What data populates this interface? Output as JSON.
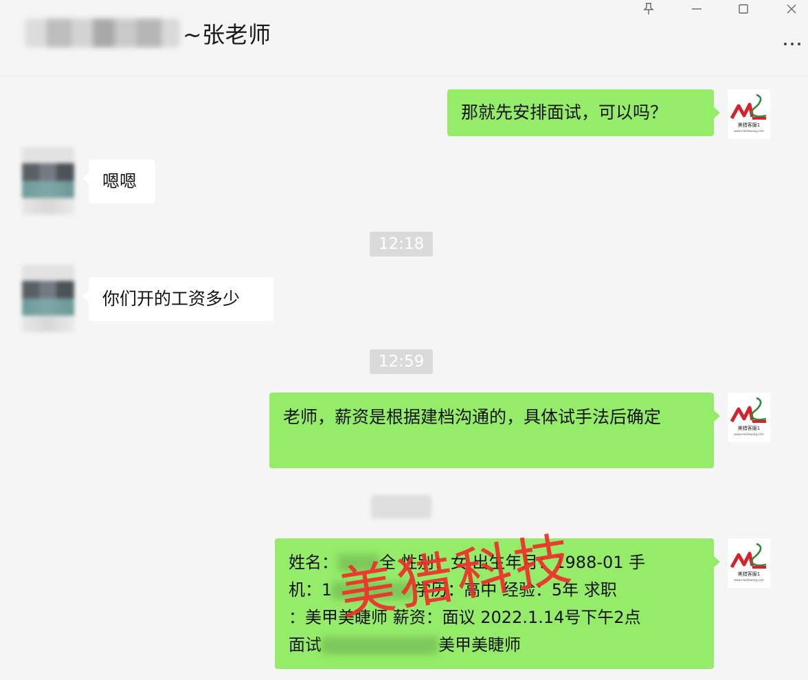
{
  "header": {
    "title": "~张老师",
    "pin_icon": "pin-icon",
    "minimize_icon": "minimize-icon",
    "maximize_icon": "maximize-icon",
    "close_icon": "close-icon",
    "more_icon": "more-icon"
  },
  "messages": [
    {
      "from": "me",
      "text": "那就先安排面试，可以吗？"
    },
    {
      "from": "other",
      "text": "嗯嗯"
    },
    {
      "time": "12:18"
    },
    {
      "from": "other",
      "text": "你们开的工资多少"
    },
    {
      "time": "12:59"
    },
    {
      "from": "me",
      "text": "老师，薪资是根据建档沟通的，具体试手法后确定"
    },
    {
      "from": "me",
      "lines": [
        {
          "a": "姓名：",
          "b": "全 性别：女 出生年月：1988-01 手"
        },
        {
          "a": "机：1",
          "b": "学历：高中 经验：5年 求职"
        },
        {
          "a": "：美甲美睫师 薪资：面议 2022.1.14号下午2点",
          "b": ""
        },
        {
          "a": "面试",
          "b": "美甲美睫师"
        }
      ]
    }
  ],
  "logo_avatar": {
    "mark": "ML",
    "caption": "美猎客服1",
    "sub": "www.meiliewang.com"
  },
  "watermark": "美猎科技",
  "colors": {
    "my_bubble": "#95ec69",
    "other_bubble": "#ffffff",
    "background": "#f5f5f5",
    "watermark": "#ef2f2a"
  }
}
